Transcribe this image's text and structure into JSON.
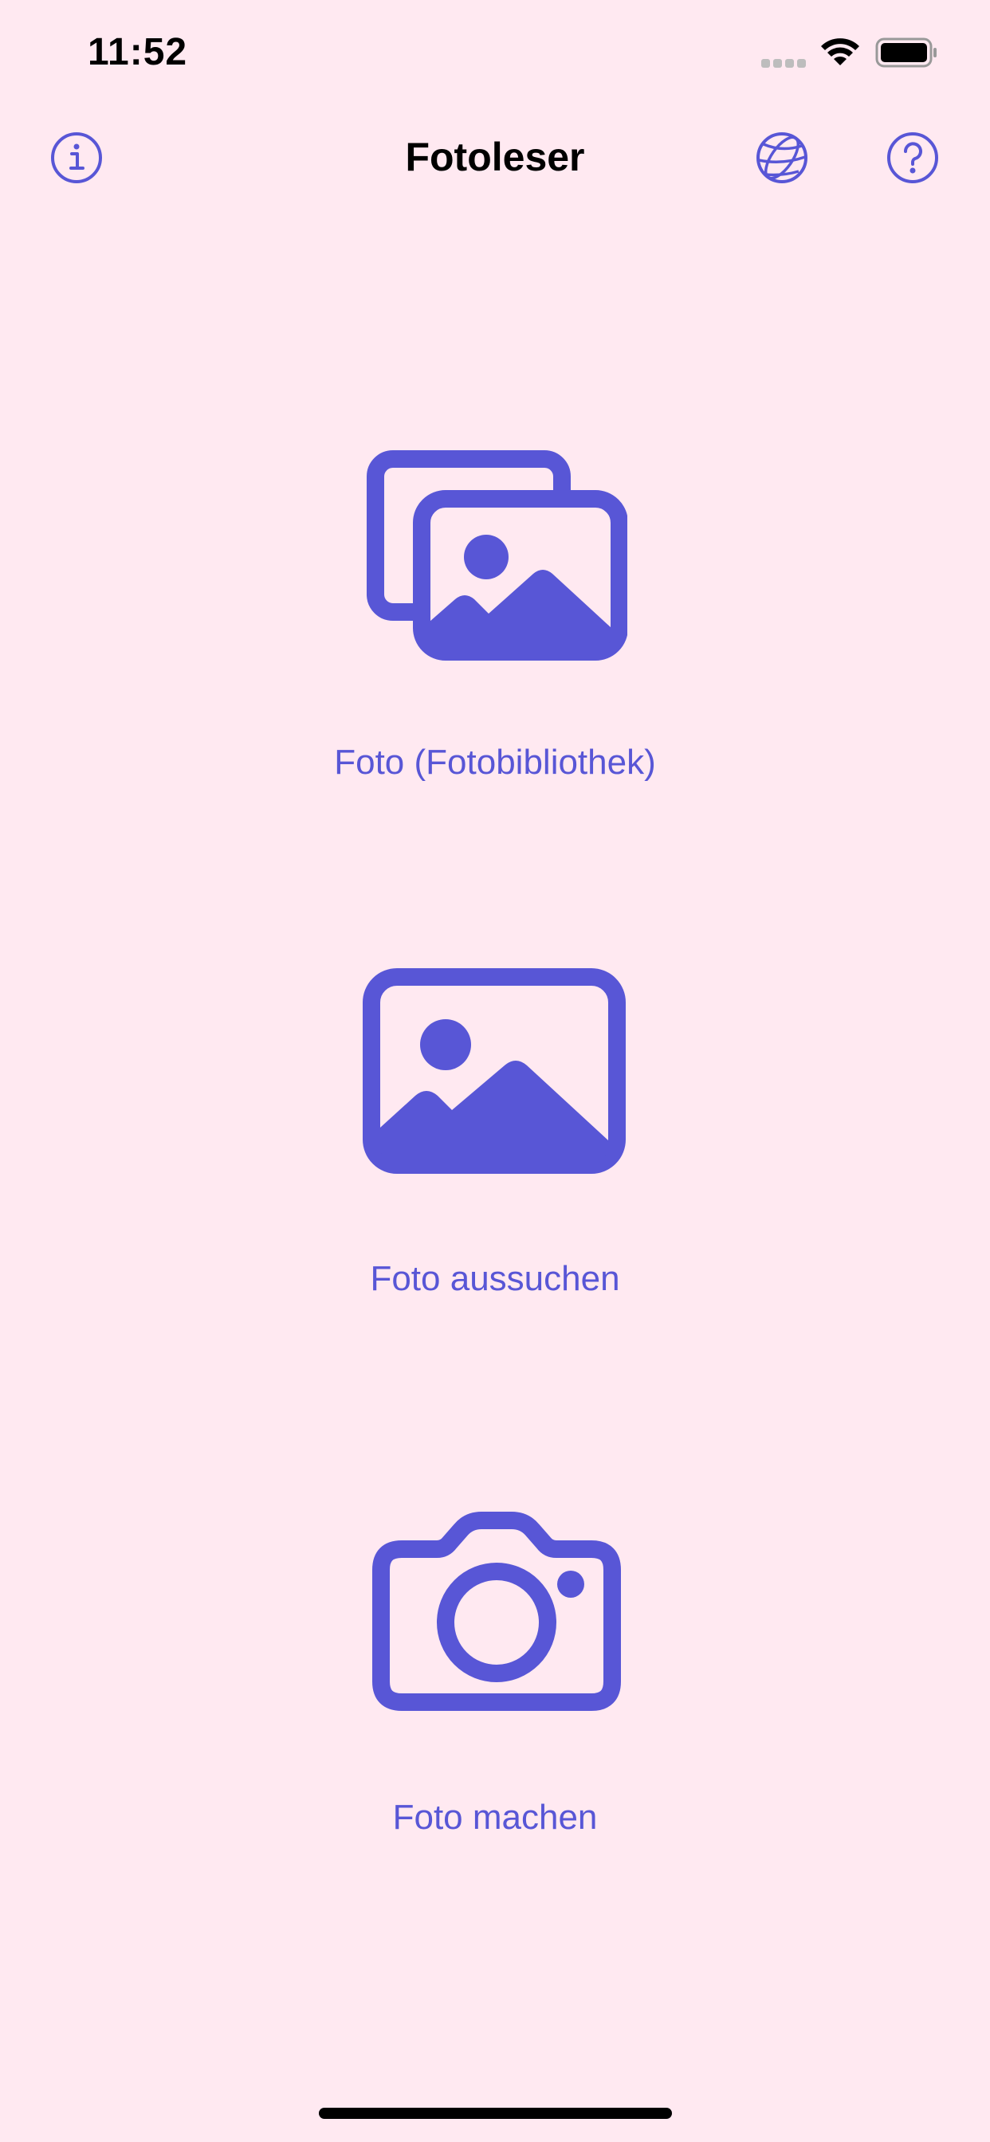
{
  "status_bar": {
    "time": "11:52"
  },
  "nav": {
    "title": "Fotoleser",
    "info_icon": "info-circle-icon",
    "globe_icon": "globe-icon",
    "help_icon": "question-circle-icon"
  },
  "actions": {
    "library": {
      "label": "Foto (Fotobibliothek)",
      "icon": "photo-stack-icon"
    },
    "choose": {
      "label": "Foto aussuchen",
      "icon": "photo-icon"
    },
    "camera": {
      "label": "Foto machen",
      "icon": "camera-icon"
    }
  },
  "colors": {
    "background": "#FFE9F1",
    "accent": "#5856D6",
    "text": "#000000"
  }
}
